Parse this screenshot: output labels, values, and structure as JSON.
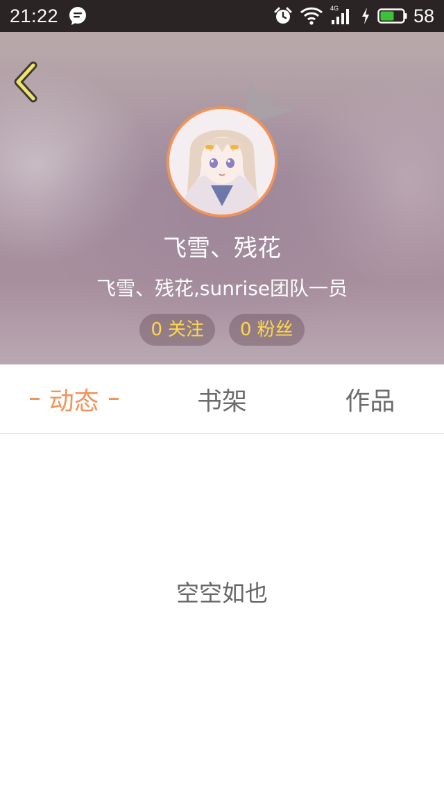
{
  "status_bar": {
    "time": "21:22",
    "network": "4G",
    "battery": "58",
    "icons": [
      "message-icon",
      "alarm-icon",
      "wifi-icon",
      "signal-icon",
      "charging-icon",
      "battery-icon"
    ],
    "battery_color": "#3cc23a"
  },
  "header": {
    "user_name": "飞雪、残花",
    "bio": "飞雪、残花,sunrise团队一员",
    "follow": {
      "count": "0",
      "label": "关注"
    },
    "fans": {
      "count": "0",
      "label": "粉丝"
    },
    "accent": "#f2935a",
    "pill_text_color": "#ffd84a"
  },
  "tabs": [
    {
      "label": "动态",
      "active": true
    },
    {
      "label": "书架",
      "active": false
    },
    {
      "label": "作品",
      "active": false
    }
  ],
  "empty_state": {
    "text": "空空如也"
  }
}
